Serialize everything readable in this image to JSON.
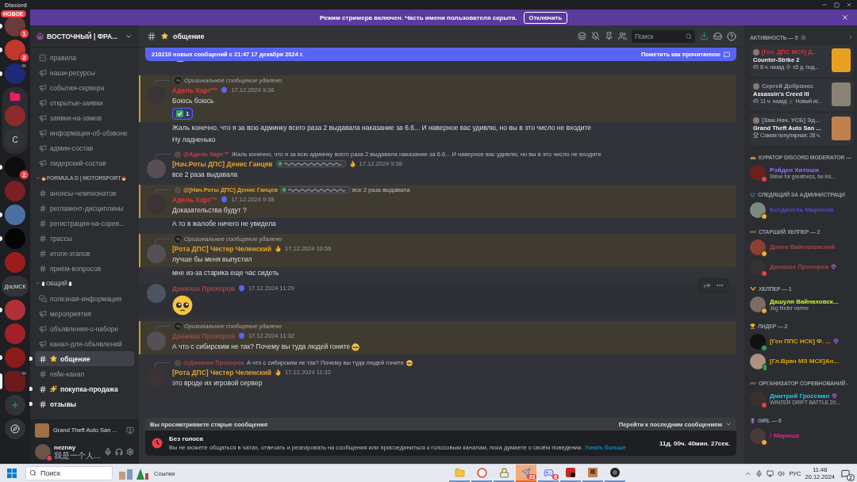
{
  "window": {
    "title": "Discord"
  },
  "banner": {
    "text": "Режим стримера включен. Часть имени пользователя скрыта.",
    "button": "Отключить"
  },
  "servers": [
    {
      "kind": "avatar",
      "color": "#6b3b3b",
      "unread": true,
      "selected": false,
      "badge": "1",
      "tag": "НОВОЕ"
    },
    {
      "kind": "avatar",
      "color": "#c0392b",
      "unread": true,
      "selected": false,
      "badge": "2"
    },
    {
      "kind": "avatar",
      "color": "#1e2a78",
      "unread": true,
      "selected": false,
      "voice": true
    },
    {
      "kind": "folder",
      "color": "#e91e63",
      "unread": false,
      "selected": false,
      "children": [
        {
          "kind": "avatar",
          "color": "#8e2a2a",
          "unread": false,
          "selected": false
        },
        {
          "kind": "text",
          "label": "С",
          "unread": false,
          "selected": false
        }
      ]
    },
    {
      "kind": "avatar",
      "color": "#0d0d0d",
      "unread": true,
      "selected": false,
      "badge": "2"
    },
    {
      "kind": "avatar",
      "color": "#7a1f24",
      "unread": false,
      "selected": false
    },
    {
      "kind": "avatar",
      "color": "#4a6fa5",
      "unread": true,
      "selected": false
    },
    {
      "kind": "avatar",
      "color": "#050505",
      "unread": true,
      "selected": false
    },
    {
      "kind": "avatar",
      "color": "#9b1c1c",
      "unread": false,
      "selected": false
    },
    {
      "kind": "text",
      "label": "ДпсМСК",
      "unread": false,
      "selected": false
    },
    {
      "kind": "avatar",
      "color": "#b0303a",
      "unread": true,
      "selected": false
    },
    {
      "kind": "avatar",
      "color": "#a31f2a",
      "unread": false,
      "selected": false
    },
    {
      "kind": "avatar",
      "color": "#8b1a1a",
      "unread": true,
      "selected": false
    },
    {
      "kind": "avatar",
      "color": "#6e1a1a",
      "unread": false,
      "selected": true,
      "voice": true
    }
  ],
  "server": {
    "name": "ВОСТОЧНЫЙ | ФРА..."
  },
  "channel_groups": [
    {
      "channels": [
        {
          "kind": "rules",
          "name": "правила",
          "unread": false,
          "selected": false
        },
        {
          "kind": "announcement",
          "name": "наши-ресурсы",
          "unread": false,
          "selected": false
        },
        {
          "kind": "announcement",
          "name": "события-сервера",
          "unread": false,
          "selected": false
        },
        {
          "kind": "announcement",
          "name": "открытые-заявки",
          "unread": false,
          "selected": false
        },
        {
          "kind": "announcement",
          "name": "заявки-на-замов",
          "unread": false,
          "selected": false
        },
        {
          "kind": "announcement",
          "name": "информация-об-обзвоне",
          "unread": false,
          "selected": false
        },
        {
          "kind": "announcement",
          "name": "админ-состав",
          "unread": false,
          "selected": false
        },
        {
          "kind": "announcement",
          "name": "лидерский-состав",
          "unread": false,
          "selected": false
        }
      ]
    },
    {
      "title": "FORMULA D | MOTORSPORT",
      "channels": [
        {
          "kind": "text",
          "name": "анонсы-чемпионатов",
          "unread": false,
          "selected": false
        },
        {
          "kind": "text",
          "name": "регламент-дисциплины",
          "unread": false,
          "selected": false
        },
        {
          "kind": "text",
          "name": "регистрация-на-сорев...",
          "unread": false,
          "selected": false
        },
        {
          "kind": "text",
          "name": "трассы",
          "unread": false,
          "selected": false
        },
        {
          "kind": "text",
          "name": "итоги-этапов",
          "unread": false,
          "selected": false
        },
        {
          "kind": "text",
          "name": "приём-вопросов",
          "unread": false,
          "selected": false
        }
      ]
    },
    {
      "title": "ОБЩИЙ",
      "channels": [
        {
          "kind": "forum",
          "name": "полезная-информация",
          "unread": false,
          "selected": false
        },
        {
          "kind": "announcement",
          "name": "мероприятия",
          "unread": false,
          "selected": false
        },
        {
          "kind": "announcement",
          "name": "объявления-о-наборе",
          "unread": false,
          "selected": false
        },
        {
          "kind": "announcement",
          "name": "канал-для-объявлений",
          "unread": false,
          "selected": false
        },
        {
          "kind": "text",
          "name": "общение",
          "unread": true,
          "selected": true
        },
        {
          "kind": "text",
          "name": "nsfw-канал",
          "unread": false,
          "selected": false
        },
        {
          "kind": "text",
          "name": "покупка-продажа",
          "unread": true,
          "selected": false
        },
        {
          "kind": "text",
          "name": "отзывы",
          "unread": true,
          "selected": false
        }
      ]
    }
  ],
  "activity_panel": {
    "game": "Grand Theft Auto San ..."
  },
  "user": {
    "name": "neznay",
    "status": "我是一个人...",
    "kind": "dnd"
  },
  "chat": {
    "channel": "общение",
    "search": {
      "placeholder": "Поиск"
    },
    "new_bar": {
      "text": "210210 новых сообщений с 21:47 17 декабря 2024 г.",
      "action": "Пометить как прочитанное"
    },
    "messages": [
      {
        "kind": "message",
        "highlighted": true,
        "hovered": false,
        "reply": {
          "kind": "deleted",
          "text": "Оригинальное сообщение удалено"
        },
        "author": "Адель Харт™",
        "color": "#d83c3e",
        "badges": [
          {
            "kind": "shield"
          }
        ],
        "time": "17.12.2024 9:36",
        "lines": [
          "Боюсь боюсь"
        ],
        "reactions": [
          {
            "count": "1",
            "mine": true
          }
        ]
      },
      {
        "kind": "continuation",
        "highlighted": false,
        "hovered": false,
        "lines": [
          "Жаль конечно, что я за всю админку всего раза 2 выдавала наказание за 6.6... И наверное вас удивлю, но вы в это число не входите",
          "Ну ладненько"
        ]
      },
      {
        "kind": "message",
        "highlighted": false,
        "hovered": false,
        "reply": {
          "kind": "message",
          "author": "@Адель Харт™",
          "color": "#d83c3e",
          "text": "Жаль конечно, что я за всю админку всего раза 2 выдавала наказание за 6.6... И наверное вас удивлю, но вы в это число не входите"
        },
        "author": "[Нач.Роты ДПС] Денис Ганцев",
        "color": "#e0a030",
        "badges": [
          {
            "kind": "tag"
          },
          {
            "kind": "fire"
          }
        ],
        "time": "17.12.2024 9:38",
        "lines": [
          "все 2 раза выдавала"
        ]
      },
      {
        "kind": "message",
        "highlighted": true,
        "hovered": false,
        "reply": {
          "kind": "message",
          "author": "@[Нач.Роты ДПС] Денис Ганцев",
          "color": "#e0a030",
          "badges": [
            {
              "kind": "tag"
            }
          ],
          "text": "все 2 раза выдавала"
        },
        "author": "Адель Харт™",
        "color": "#d83c3e",
        "badges": [
          {
            "kind": "shield"
          }
        ],
        "time": "17.12.2024 9:38",
        "lines": [
          "Доказательства будут ?"
        ]
      },
      {
        "kind": "continuation",
        "highlighted": false,
        "hovered": false,
        "lines": [
          "А то в жалобе ничего не увидела"
        ]
      },
      {
        "kind": "message",
        "highlighted": true,
        "hovered": false,
        "reply": {
          "kind": "deleted",
          "text": "Оригинальное сообщение удалено"
        },
        "author": "[Рота ДПС] Честер Челенский",
        "color": "#e0a030",
        "badges": [
          {
            "kind": "fire"
          }
        ],
        "time": "17.12.2024 10:56",
        "lines": [
          "лучше бы меня выпустил"
        ]
      },
      {
        "kind": "continuation",
        "highlighted": false,
        "hovered": false,
        "lines": [
          "мне из-за старика еще час сидеть"
        ]
      },
      {
        "kind": "message",
        "highlighted": false,
        "hovered": true,
        "author": "Данюша Прохоров",
        "color": "#a0454a",
        "badges": [
          {
            "kind": "shield"
          }
        ],
        "time": "17.12.2024 11:29",
        "jumbo_emoji": true
      },
      {
        "kind": "message",
        "highlighted": true,
        "hovered": false,
        "reply": {
          "kind": "deleted",
          "text": "Оригинальное сообщение удалено"
        },
        "author": "Данюша Прохоров",
        "color": "#a0454a",
        "badges": [
          {
            "kind": "shield"
          }
        ],
        "time": "17.12.2024 11:32",
        "lines": [
          "А что с сибирским не так? Почему вы туда людей гоните"
        ],
        "trailing_emoji": true
      },
      {
        "kind": "message",
        "highlighted": false,
        "hovered": false,
        "reply": {
          "kind": "message",
          "author": "@Данюша Прохоров",
          "color": "#a0454a",
          "text": "А что с сибирским не так? Почему вы туда людей гоните",
          "trailing_emoji": true
        },
        "author": "[Рота ДПС] Честер Челенский",
        "color": "#e0a030",
        "badges": [
          {
            "kind": "fire"
          }
        ],
        "time": "17.12.2024 11:32",
        "lines": [
          "это вроде их игровой сервер"
        ]
      }
    ],
    "old_bar": {
      "text": "Вы просматриваете старые сообщения",
      "action": "Перейти к последним сообщениям"
    },
    "timeout": {
      "title": "Без голоса",
      "text": "Вы не можете общаться в чатах, отвечать и реагировать на сообщения или присоединиться к голосовым каналам, пока думаете о своём поведении.",
      "link": "Узнать больше",
      "timer": "11д. 00ч. 40мин. 27сек."
    }
  },
  "members": {
    "activity_title": "АКТИВНОСТЬ — 5",
    "activities": [
      {
        "user": "[Ген. ДПС МСК] Д...",
        "color": "#e03030",
        "game": "Counter-Strike 2",
        "meta": [
          {
            "kind": "gamepad",
            "text": "8 ч. назад"
          },
          {
            "kind": "bolt",
            "text": "x5 д. под..."
          }
        ]
      },
      {
        "user": "Сергей Доброноc",
        "color": "#949ba4",
        "game": "Assassin's Creed III",
        "meta": [
          {
            "kind": "gamepad",
            "text": "11 ч. назад"
          },
          {
            "kind": "new",
            "text": "Новый иг..."
          }
        ]
      },
      {
        "user": "[Зам.Нач. УСБ] Эд...",
        "color": "#949ba4",
        "game": "Grand Theft Auto San ...",
        "meta": [
          {
            "kind": "trophy",
            "text": "Самая популярная: 28 ч."
          }
        ]
      }
    ],
    "groups": [
      {
        "title": "КУРАТОР DISCORD MODERATOR —",
        "members": [
          {
            "name": "Рэйден Хитоши",
            "color": "#9b6bff",
            "kind": "dnd",
            "sub": "Strive for greatness, be ins..."
          }
        ]
      },
      {
        "title": "СЛЕДЯЩИЙ ЗА АДМИНИСТРАЦИ",
        "members": [
          {
            "name": "Богданель Миронов",
            "color": "#4f46e5",
            "kind": "idle"
          }
        ]
      },
      {
        "title": "СТАРШИЙ ХЕЛПЕР — 2",
        "members": [
          {
            "name": "Данек Вайнаховский",
            "color": "#a0454a",
            "kind": "idle"
          },
          {
            "name": "Данюша Прохоров",
            "color": "#a0454a",
            "kind": "dnd",
            "nitro": true
          }
        ]
      },
      {
        "title": "ХЕЛПЕР — 1",
        "members": [
          {
            "name": "Дашуля Вайнаховск...",
            "color": "#c6f135",
            "kind": "idle",
            "sub": "Jeg finder varme"
          }
        ]
      },
      {
        "title": "ЛИДЕР — 2",
        "members": [
          {
            "name": "[Ген ППС НСК] Ф. ...",
            "color": "#e0a500",
            "kind": "online",
            "nitro": true
          },
          {
            "name": "[Гл.Врач МЗ МСК]Ан...",
            "color": "#e0a500",
            "kind": "mobile"
          }
        ]
      },
      {
        "title": "ОРГАНИЗАТОР СОРЕВНОВАНИЙ -",
        "members": [
          {
            "name": "Дмитрий Гроссман",
            "color": "#22c3e6",
            "kind": "dnd",
            "nitro": true,
            "sub": "WINTER DRIFT BATTLE 20..."
          }
        ]
      },
      {
        "title": "GIRL — 6",
        "members": [
          {
            "name": "! Мариша",
            "color": "#e91e8c",
            "kind": "idle"
          }
        ]
      }
    ]
  },
  "taskbar": {
    "search": {
      "placeholder": "Поиск"
    },
    "links": "Ссылки",
    "apps": [
      {
        "kind": "folder",
        "active": false
      },
      {
        "kind": "browser",
        "active": false
      },
      {
        "kind": "lock",
        "active": false
      },
      {
        "kind": "telegram",
        "active": true,
        "badge": "33"
      },
      {
        "kind": "discord",
        "active": false,
        "badge": "6"
      },
      {
        "kind": "media",
        "active": false
      },
      {
        "kind": "game",
        "active": false
      },
      {
        "kind": "obs",
        "active": false
      }
    ],
    "language": "РУС",
    "time": "11:48",
    "date": "20.12.2024",
    "notifications": "2"
  }
}
